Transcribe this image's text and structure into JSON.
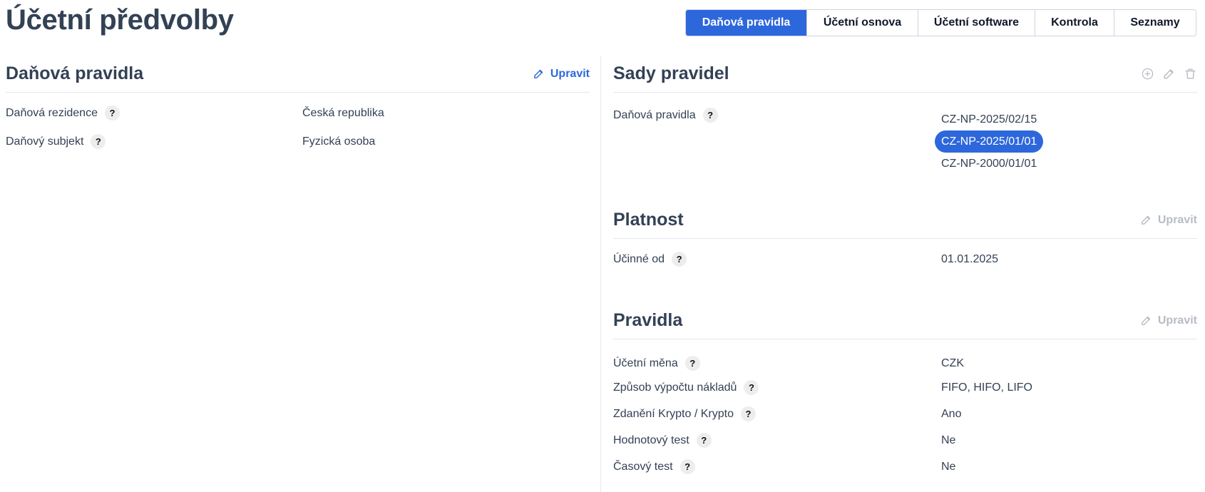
{
  "page": {
    "title": "Účetní předvolby"
  },
  "tabs": [
    {
      "label": "Daňová pravidla",
      "active": true
    },
    {
      "label": "Účetní osnova",
      "active": false
    },
    {
      "label": "Účetní software",
      "active": false
    },
    {
      "label": "Kontrola",
      "active": false
    },
    {
      "label": "Seznamy",
      "active": false
    }
  ],
  "tax_rules": {
    "title": "Daňová pravidla",
    "edit_label": "Upravit",
    "rows": [
      {
        "label": "Daňová rezidence",
        "value": "Česká republika"
      },
      {
        "label": "Daňový subjekt",
        "value": "Fyzická osoba"
      }
    ]
  },
  "rule_sets": {
    "title": "Sady pravidel",
    "icons": [
      "add-icon",
      "edit-icon",
      "delete-icon"
    ],
    "label": "Daňová pravidla",
    "items": [
      {
        "name": "CZ-NP-2025/02/15",
        "selected": false
      },
      {
        "name": "CZ-NP-2025/01/01",
        "selected": true
      },
      {
        "name": "CZ-NP-2000/01/01",
        "selected": false
      }
    ]
  },
  "validity": {
    "title": "Platnost",
    "edit_label": "Upravit",
    "rows": [
      {
        "label": "Účinné od",
        "value": "01.01.2025"
      }
    ]
  },
  "rules": {
    "title": "Pravidla",
    "edit_label": "Upravit",
    "rows": [
      {
        "label": "Účetní měna",
        "value": "CZK"
      },
      {
        "label": "Způsob výpočtu nákladů",
        "value": "FIFO, HIFO, LIFO"
      },
      {
        "label": "Zdanění Krypto / Krypto",
        "value": "Ano"
      },
      {
        "label": "Hodnotový test",
        "value": "Ne"
      },
      {
        "label": "Časový test",
        "value": "Ne"
      }
    ]
  },
  "help_glyph": "?",
  "colors": {
    "accent": "#2d67dc",
    "text": "#334155",
    "disabled": "#b7bcc4",
    "divider": "#e5e7eb"
  }
}
